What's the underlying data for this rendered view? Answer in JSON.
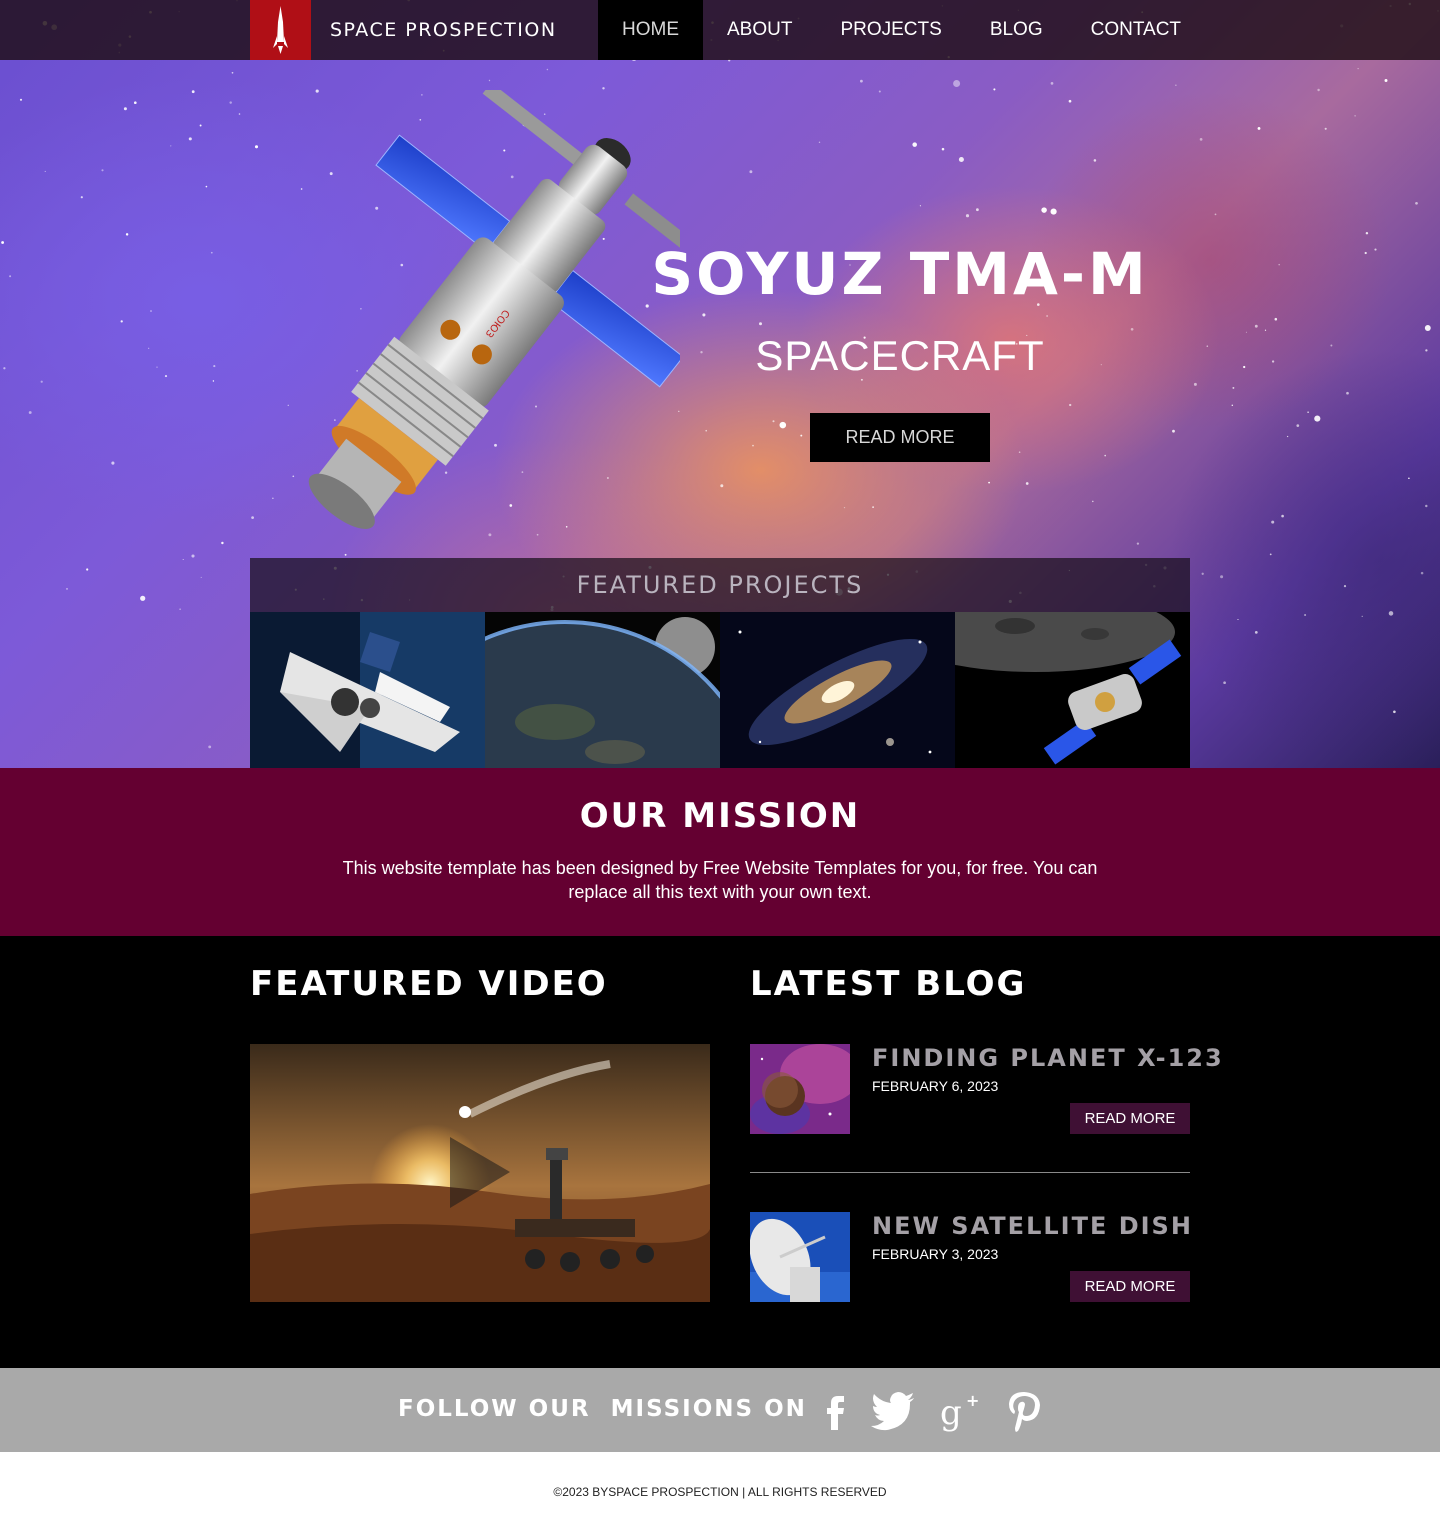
{
  "header": {
    "brand": "SPACE PROSPECTION",
    "nav": [
      "HOME",
      "ABOUT",
      "PROJECTS",
      "BLOG",
      "CONTACT"
    ],
    "active_nav": "HOME"
  },
  "hero": {
    "title": "SOYUZ TMA-M",
    "subtitle": "SPACECRAFT",
    "button": "READ MORE"
  },
  "featured_projects": {
    "title": "FEATURED PROJECTS",
    "items": [
      "space-shuttle-image",
      "earth-horizon-image",
      "galaxy-image",
      "satellite-moon-image"
    ]
  },
  "mission": {
    "title": "OUR MISSION",
    "text": "This website template has been designed by Free Website Templates for you, for free. You can replace all this text with your own text."
  },
  "video": {
    "title": "FEATURED VIDEO",
    "icon": "play-icon"
  },
  "blog": {
    "title": "LATEST BLOG",
    "posts": [
      {
        "title": "FINDING PLANET X-123",
        "date": "FEBRUARY 6, 2023",
        "button": "READ MORE"
      },
      {
        "title": "NEW SATELLITE DISH",
        "date": "FEBRUARY 3, 2023",
        "button": "READ MORE"
      }
    ]
  },
  "social": {
    "label": "FOLLOW OUR  MISSIONS ON",
    "icons": [
      "facebook-icon",
      "twitter-icon",
      "google-plus-icon",
      "pinterest-icon"
    ]
  },
  "footer": {
    "copyright": "©2023 BYSPACE PROSPECTION | ALL RIGHTS RESERVED"
  },
  "colors": {
    "logo_red": "#b00f16",
    "mission_bg": "#640031",
    "blog_button": "#3f1034",
    "social_bg": "#a9a9a9"
  }
}
